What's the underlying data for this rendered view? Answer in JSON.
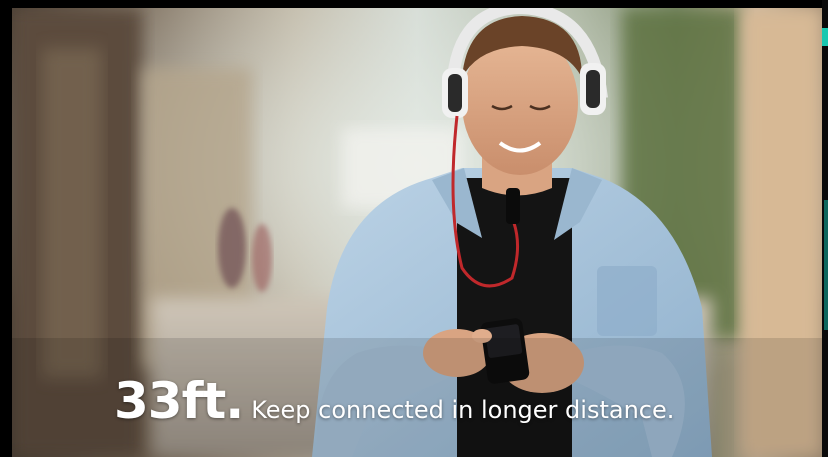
{
  "headline": {
    "distance": "33ft.",
    "tagline": "Keep connected in longer distance."
  },
  "colors": {
    "text": "#ffffff",
    "accent": "#19c8b0",
    "shirt": "#a9c4dc",
    "tee": "#111111",
    "cable": "#c0282b"
  }
}
